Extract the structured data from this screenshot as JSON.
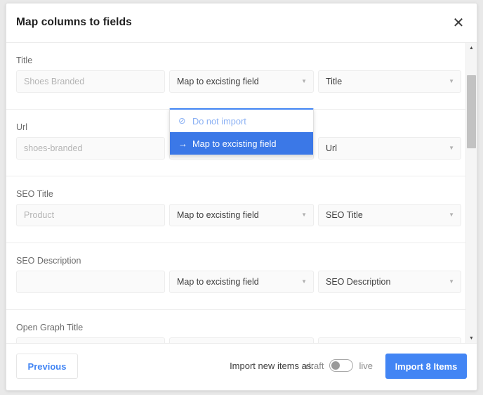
{
  "modal": {
    "title": "Map columns to fields",
    "close_icon": "close-icon"
  },
  "columns": {
    "source_name": "source-column",
    "action_name": "action-select",
    "target_name": "target-field-select"
  },
  "rows": [
    {
      "label": "Title",
      "source_value": "Shoes Branded",
      "action_value": "Map to excisting field",
      "target_value": "Title",
      "dropdown_open": true
    },
    {
      "label": "Url",
      "source_value": "shoes-branded",
      "action_value": "Map to excisting field",
      "target_value": "Url",
      "dropdown_open": false
    },
    {
      "label": "SEO Title",
      "source_value": "Product",
      "action_value": "Map to excisting field",
      "target_value": "SEO Title",
      "dropdown_open": false
    },
    {
      "label": "SEO Description",
      "source_value": "",
      "action_value": "Map to excisting field",
      "target_value": "SEO Description",
      "dropdown_open": false
    },
    {
      "label": "Open Graph Title",
      "source_value": "",
      "action_value": "",
      "target_value": "",
      "dropdown_open": false
    }
  ],
  "dropdown": {
    "items": [
      {
        "label": "Do not import",
        "icon": "no-entry-icon",
        "glyph": "⊘",
        "selected": false
      },
      {
        "label": "Map to excisting field",
        "icon": "arrow-right-icon",
        "glyph": "→",
        "selected": true
      }
    ]
  },
  "scrollbar": {
    "up_glyph": "▲",
    "down_glyph": "▼"
  },
  "footer": {
    "previous_label": "Previous",
    "import_as_label": "Import new items as:",
    "toggle_left_label": "draft",
    "toggle_right_label": "live",
    "toggle_state": "draft",
    "import_label": "Import 8 Items"
  },
  "colors": {
    "accent": "#4285f4",
    "selected_item": "#3b78e7",
    "muted_text": "#b4b4b4",
    "label_text": "#6b6b6b"
  },
  "caret_glyph": "▼"
}
